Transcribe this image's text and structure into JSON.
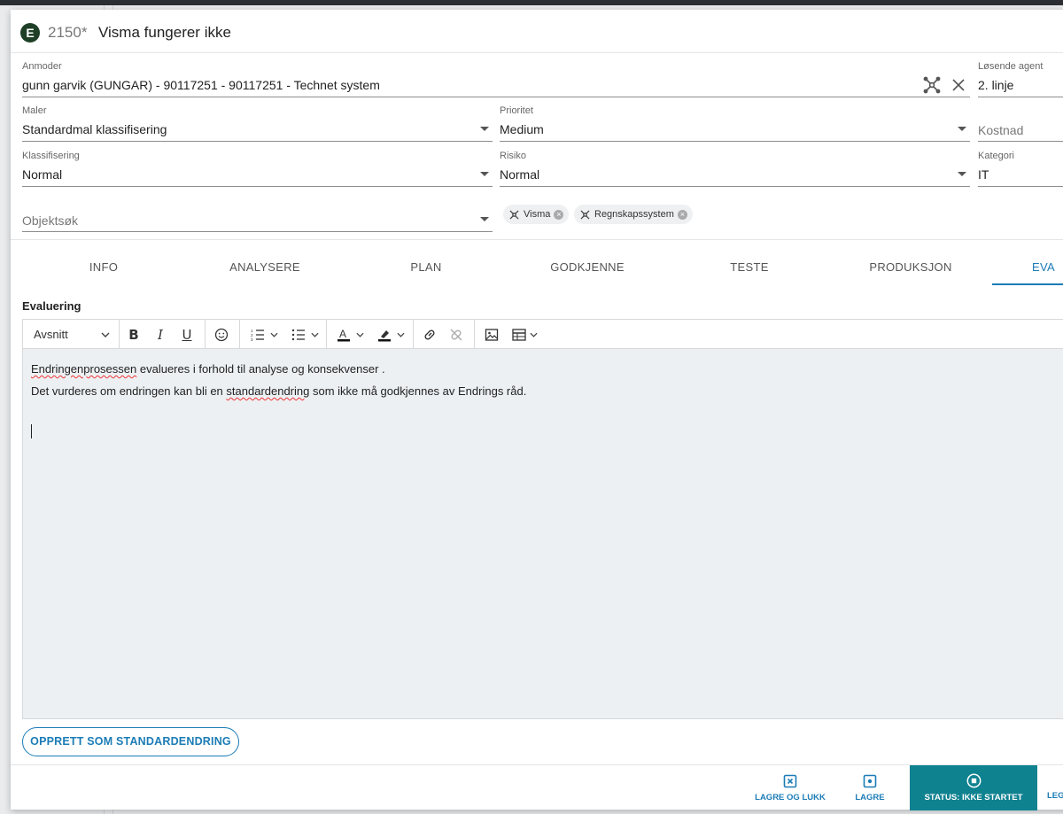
{
  "header": {
    "badge": "E",
    "number": "2150*",
    "title": "Visma fungerer ikke"
  },
  "form": {
    "requester": {
      "label": "Anmoder",
      "value": "gunn garvik (GUNGAR) - 90117251 - 90117251 - Technet system"
    },
    "agent": {
      "label": "Løsende agent",
      "value": "2. linje"
    },
    "template": {
      "label": "Maler",
      "value": "Standardmal klassifisering"
    },
    "priority": {
      "label": "Prioritet",
      "value": "Medium"
    },
    "cost": {
      "placeholder": "Kostnad"
    },
    "classification": {
      "label": "Klassifisering",
      "value": "Normal"
    },
    "risk": {
      "label": "Risiko",
      "value": "Normal"
    },
    "category": {
      "label": "Kategori",
      "value": "IT"
    },
    "object_search": {
      "placeholder": "Objektsøk"
    },
    "chips": [
      "Visma",
      "Regnskapssystem"
    ]
  },
  "tabs": [
    "INFO",
    "ANALYSERE",
    "PLAN",
    "GODKJENNE",
    "TESTE",
    "PRODUKSJON",
    "EVA"
  ],
  "active_tab_index": 6,
  "section_title": "Evaluering",
  "editor": {
    "paragraph_style": "Avsnitt",
    "line1_word": "Endringenprosessen",
    "line1_rest": " evalueres i forhold til analyse og konsekvenser .",
    "line2_start": "Det vurderes om endringen kan bli en ",
    "line2_word": "standardendring",
    "line2_rest": " som ikke må godkjennes av Endrings råd."
  },
  "std_button": "OPPRETT SOM STANDARDENDRING",
  "footer": {
    "save_close": "LAGRE OG LUKK",
    "save": "LAGRE",
    "status": "STATUS: IKKE STARTET",
    "cut_off": "LEG"
  },
  "colors": {
    "accent": "#1b7cb6",
    "status_bg": "#0f8290",
    "badge_bg": "#1e3f26",
    "editor_bg": "#edf0f3"
  }
}
